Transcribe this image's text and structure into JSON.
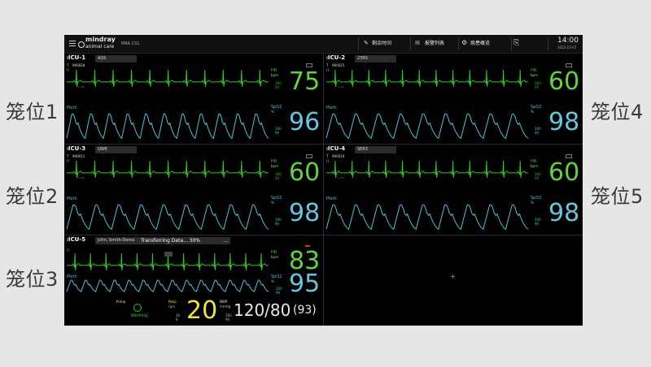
{
  "side_labels": [
    "笼位1",
    "笼位2",
    "笼位3",
    "笼位4",
    "笼位5"
  ],
  "topbar": {
    "brand_top": "mindray",
    "brand_bottom": "animal care",
    "device": "MRA CS1",
    "menu1": "剩余时间",
    "menu2": "报警列表",
    "menu3": "病患概览",
    "time": "14:00",
    "date": "2023-12-07"
  },
  "beds": [
    {
      "bed": "ICU-1",
      "name": "AQS",
      "id": "990028",
      "hr": "75",
      "spo2": "96",
      "hr_unit": "bpm",
      "spo2_unit": "%"
    },
    {
      "bed": "ICU-2",
      "name": "23RS",
      "id": "990025",
      "hr": "60",
      "spo2": "98",
      "hr_unit": "bpm",
      "spo2_unit": "%"
    },
    {
      "bed": "ICU-3",
      "name": "QWE",
      "id": "990011",
      "hr": "60",
      "spo2": "98",
      "hr_unit": "bpm",
      "spo2_unit": "%"
    },
    {
      "bed": "ICU-4",
      "name": "SER3",
      "id": "990019",
      "hr": "60",
      "spo2": "98",
      "hr_unit": "bpm",
      "spo2_unit": "%"
    },
    {
      "bed": "ICU-5",
      "name": "John, Smith-Demo",
      "id": "",
      "hr": "83",
      "spo2": "95",
      "hr_unit": "bpm",
      "spo2_unit": "%"
    }
  ],
  "labels": {
    "ecg": "II",
    "pleth": "Pleth",
    "hr": "HR",
    "spo2": "SpO2",
    "hr_hi": "160",
    "hr_lo": "50",
    "sp_hi": "100",
    "sp_lo": "90",
    "ecg_1mv": "1 mV"
  },
  "transfer": "Transferring Data... 30%",
  "ellipsis": "...",
  "pump": "Pump",
  "working": "Working",
  "resp": {
    "label": "Resp",
    "unit": "rpm",
    "value": "20",
    "hi": "30",
    "lo": "8"
  },
  "nibp": {
    "label": "NIBP",
    "unit": "mmHg",
    "value": "120/80",
    "map": "(93)",
    "hi": "160",
    "lo": "90"
  },
  "empty_plus": "+",
  "colors": {
    "ecg": "#35c52a",
    "pleth": "#4fc3d6",
    "hr": "#61d33b",
    "spo2": "#63c6df",
    "resp": "#f2e33a"
  }
}
